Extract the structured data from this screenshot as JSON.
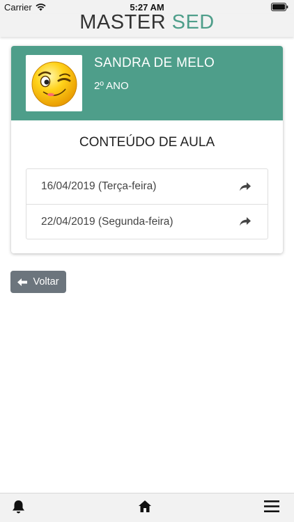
{
  "status_bar": {
    "carrier": "Carrier",
    "time": "5:27 AM"
  },
  "header": {
    "brand_main": "MASTER",
    "brand_accent": "SED"
  },
  "student": {
    "name": "SANDRA DE MELO",
    "grade": "2º ANO"
  },
  "section": {
    "title": "CONTEÚDO DE AULA"
  },
  "entries": [
    {
      "label": "16/04/2019 (Terça-feira)"
    },
    {
      "label": "22/04/2019 (Segunda-feira)"
    }
  ],
  "back_button": {
    "label": "Voltar"
  },
  "tabbar": {
    "items": [
      "bell-icon",
      "home-icon",
      "menu-icon"
    ]
  },
  "colors": {
    "accent": "#4e9e8a",
    "button": "#6c757d"
  }
}
